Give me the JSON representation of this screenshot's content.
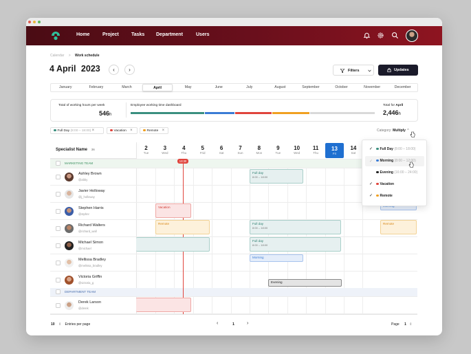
{
  "nav": {
    "links": [
      "Home",
      "Project",
      "Tasks",
      "Department",
      "Users"
    ]
  },
  "breadcrumb": {
    "parent": "Calendar",
    "separator": ">",
    "current": "Work schedule"
  },
  "date": {
    "day_month": "4 April",
    "year": "2023"
  },
  "buttons": {
    "prev": "‹",
    "next": "›",
    "filters": "Filters",
    "updates": "Updates"
  },
  "months": [
    "January",
    "February",
    "March",
    "April",
    "May",
    "June",
    "July",
    "August",
    "September",
    "October",
    "November",
    "December"
  ],
  "selected_month": "April",
  "summary": {
    "total_label": "Total of working hours per week",
    "total_value": "546",
    "total_unit": "h",
    "dashboard_label": "Employee working time dashboard",
    "april_label_prefix": "Total for",
    "april_label_month": "April",
    "april_value": "2,446",
    "april_unit": "h"
  },
  "legend": [
    {
      "label": "Full Day",
      "time": "(8:00 – 18:00)",
      "color": "#3a8f7f"
    },
    {
      "label": "Vacation",
      "time": "",
      "color": "#e0443c"
    },
    {
      "label": "Remote",
      "time": "",
      "color": "#f0a020"
    }
  ],
  "category": {
    "label": "Category:",
    "value": "Multiply"
  },
  "dropdown": [
    {
      "label": "Full Day",
      "time": "(8:00 – 18:00)",
      "checked": true,
      "color": "#3a8f7f"
    },
    {
      "label": "Morning",
      "time": "(8:00 – 12:00)",
      "checked": true,
      "color": "#3a7bd5"
    },
    {
      "label": "Evening",
      "time": "(16:00 – 24:00)",
      "checked": false,
      "color": "#222222"
    },
    {
      "label": "Vacation",
      "time": "",
      "checked": true,
      "color": "#e0443c"
    },
    {
      "label": "Remote",
      "time": "",
      "checked": true,
      "color": "#f0a020"
    }
  ],
  "table": {
    "specialist_header": "Specialist Name",
    "count": "36",
    "marketing_team": "MARKETING TEAM",
    "department_team": "DEPARTMENT TEAM",
    "current_time": "13:30"
  },
  "days": [
    {
      "n": "2",
      "d": "Tue"
    },
    {
      "n": "3",
      "d": "Wed"
    },
    {
      "n": "4",
      "d": "Thu"
    },
    {
      "n": "5",
      "d": "Frid"
    },
    {
      "n": "6",
      "d": "Sat"
    },
    {
      "n": "7",
      "d": "Sun"
    },
    {
      "n": "8",
      "d": "Mon"
    },
    {
      "n": "9",
      "d": "Tue"
    },
    {
      "n": "10",
      "d": "Wed"
    },
    {
      "n": "11",
      "d": "Thu"
    },
    {
      "n": "13",
      "d": "Fri"
    },
    {
      "n": "14",
      "d": "Sat"
    }
  ],
  "people": [
    {
      "name": "Ashley Brown",
      "user": "@abby"
    },
    {
      "name": "Javier Holloway",
      "user": "@j_holloway"
    },
    {
      "name": "Stephen Harris",
      "user": "@stphnr"
    },
    {
      "name": "Richard Walters",
      "user": "@richard_wall"
    },
    {
      "name": "Michael Simon",
      "user": "@michael"
    },
    {
      "name": "Mellissa Bradley",
      "user": "@melissa_bradley"
    },
    {
      "name": "Victoria Griffin",
      "user": "@victoria_g"
    },
    {
      "name": "Derek Larson",
      "user": "@derek"
    }
  ],
  "events": {
    "full_day": "Full day",
    "full_day_time": "8:00 – 18:00",
    "vacation": "Vacation",
    "remote": "Remote",
    "morning": "Morning",
    "evening": "Evening"
  },
  "footer": {
    "entries": "10",
    "entries_label": "Entries per page",
    "page_current": "1",
    "page_label": "Page",
    "page_value": "1",
    "prev": "‹",
    "next": "›"
  }
}
